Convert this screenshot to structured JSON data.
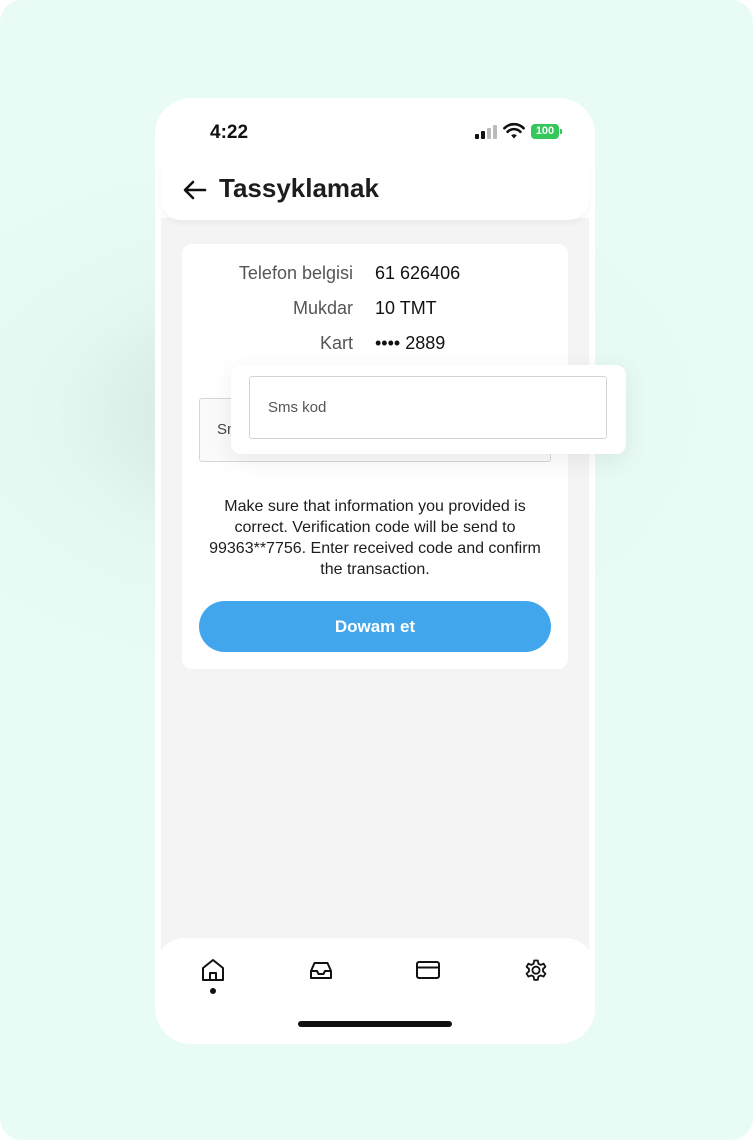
{
  "status_bar": {
    "time": "4:22",
    "battery": "100",
    "icons": [
      "signal-icon",
      "wifi-icon",
      "battery-icon"
    ]
  },
  "header": {
    "title": "Tassyklamak",
    "back_icon": "arrow-left-icon"
  },
  "details": [
    {
      "label": "Telefon belgisi",
      "value": "61 626406"
    },
    {
      "label": "Mukdar",
      "value": "10 TMT"
    },
    {
      "label": "Kart",
      "value": "•••• 2889"
    }
  ],
  "sms_field": {
    "placeholder": "Sms kod",
    "behind_text": "Sms kod",
    "value": ""
  },
  "note": "Make sure that information you provided is correct. Verification code will be send to 99363**7756. Enter received code and confirm the transaction.",
  "continue_button": "Dowam et",
  "tabbar": {
    "items": [
      {
        "name": "home",
        "icon": "home-icon",
        "active": true
      },
      {
        "name": "inbox",
        "icon": "inbox-icon",
        "active": false
      },
      {
        "name": "cards",
        "icon": "card-icon",
        "active": false
      },
      {
        "name": "settings",
        "icon": "gear-icon",
        "active": false
      }
    ]
  },
  "colors": {
    "background": "#e9fbf5",
    "accent": "#41a6ec",
    "battery": "#34c759"
  }
}
